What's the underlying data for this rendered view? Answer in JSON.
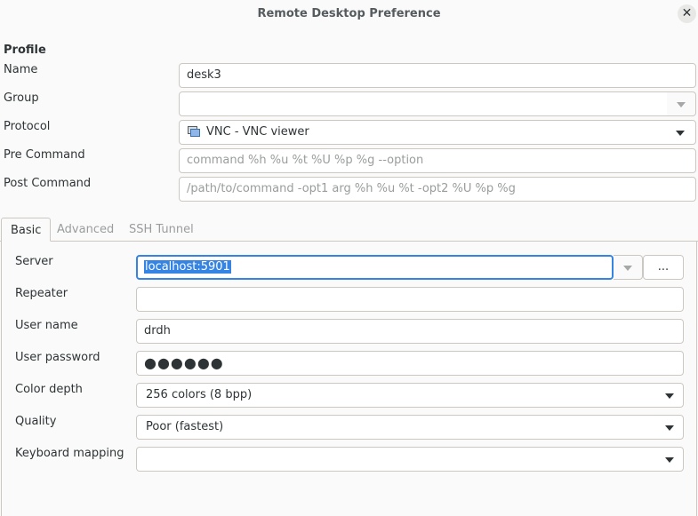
{
  "window": {
    "title": "Remote Desktop Preference",
    "close_glyph": "✕"
  },
  "profile": {
    "heading": "Profile",
    "name_label": "Name",
    "name_value": "desk3",
    "group_label": "Group",
    "group_value": "",
    "protocol_label": "Protocol",
    "protocol_value": "VNC - VNC viewer",
    "pre_command_label": "Pre Command",
    "pre_command_placeholder": "command %h %u %t %U %p %g --option",
    "post_command_label": "Post Command",
    "post_command_placeholder": "/path/to/command -opt1 arg %h %u %t -opt2 %U %p %g"
  },
  "tabs": [
    {
      "label": "Basic",
      "active": true
    },
    {
      "label": "Advanced",
      "active": false
    },
    {
      "label": "SSH Tunnel",
      "active": false
    }
  ],
  "basic": {
    "server_label": "Server",
    "server_value": "localhost:5901",
    "browse_label": "...",
    "repeater_label": "Repeater",
    "repeater_value": "",
    "username_label": "User name",
    "username_value": "drdh",
    "password_label": "User password",
    "password_mask": "●●●●●●",
    "color_depth_label": "Color depth",
    "color_depth_value": "256 colors (8 bpp)",
    "quality_label": "Quality",
    "quality_value": "Poor (fastest)",
    "keyboard_label": "Keyboard mapping",
    "keyboard_value": ""
  },
  "colors": {
    "accent": "#3584e4",
    "border": "#cdc7c2",
    "background": "#fafafa"
  }
}
